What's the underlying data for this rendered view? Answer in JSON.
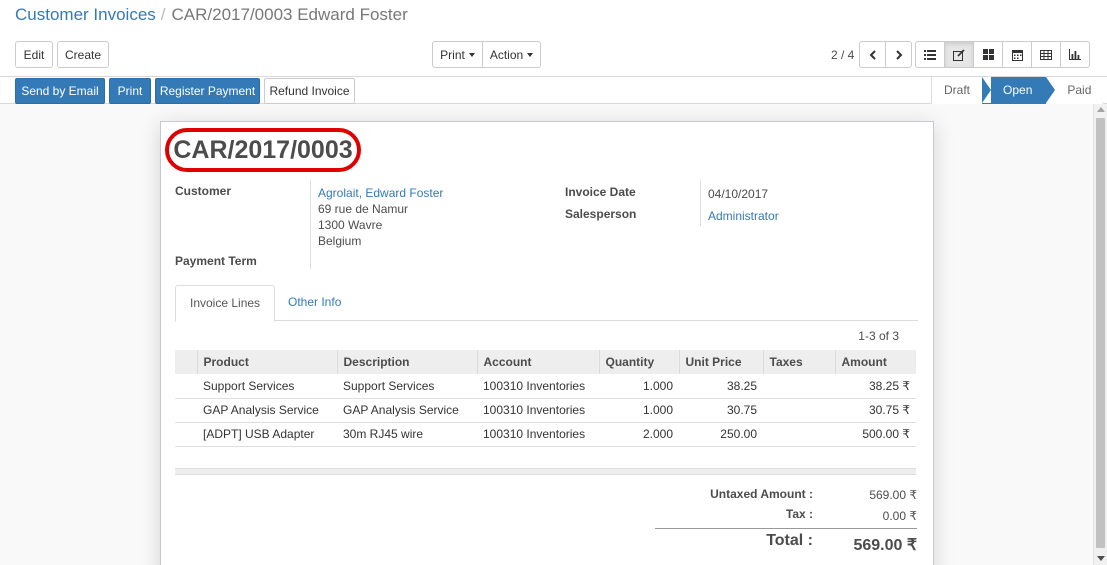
{
  "breadcrumb": {
    "parent": "Customer Invoices",
    "separator": "/",
    "current": "CAR/2017/0003 Edward Foster"
  },
  "toolbar": {
    "edit": "Edit",
    "create": "Create",
    "print": "Print",
    "action": "Action",
    "pager": "2 / 4"
  },
  "view_icons": [
    "list-icon",
    "form-icon",
    "kanban-icon",
    "calendar-icon",
    "pivot-icon",
    "graph-icon"
  ],
  "header": {
    "send_by_email": "Send by Email",
    "print": "Print",
    "register_payment": "Register Payment",
    "refund_invoice": "Refund Invoice",
    "statuses": [
      "Draft",
      "Open",
      "Paid"
    ],
    "active_status": "Open"
  },
  "invoice": {
    "number": "CAR/2017/0003",
    "customer_label": "Customer",
    "customer_name": "Agrolait, Edward Foster",
    "address_line1": "69 rue de Namur",
    "address_line2": "1300 Wavre",
    "address_line3": "Belgium",
    "payment_term_label": "Payment Term",
    "invoice_date_label": "Invoice Date",
    "invoice_date": "04/10/2017",
    "salesperson_label": "Salesperson",
    "salesperson": "Administrator"
  },
  "tabs": [
    "Invoice Lines",
    "Other Info"
  ],
  "lines": {
    "counter": "1-3 of 3",
    "columns": [
      "Product",
      "Description",
      "Account",
      "Quantity",
      "Unit Price",
      "Taxes",
      "Amount"
    ],
    "rows": [
      {
        "product": "Support Services",
        "description": "Support Services",
        "account": "100310 Inventories",
        "quantity": "1.000",
        "unit_price": "38.25",
        "taxes": "",
        "amount": "38.25 ₹"
      },
      {
        "product": "GAP Analysis Service",
        "description": "GAP Analysis Service",
        "account": "100310 Inventories",
        "quantity": "1.000",
        "unit_price": "30.75",
        "taxes": "",
        "amount": "30.75 ₹"
      },
      {
        "product": "[ADPT] USB Adapter",
        "description": "30m RJ45 wire",
        "account": "100310 Inventories",
        "quantity": "2.000",
        "unit_price": "250.00",
        "taxes": "",
        "amount": "500.00 ₹"
      }
    ]
  },
  "totals": {
    "untaxed_label": "Untaxed Amount :",
    "untaxed_value": "569.00 ₹",
    "tax_label": "Tax :",
    "tax_value": "0.00 ₹",
    "total_label": "Total :",
    "total_value": "569.00 ₹"
  },
  "colors": {
    "primary": "#337ab7",
    "highlight_circle": "#e00000"
  }
}
